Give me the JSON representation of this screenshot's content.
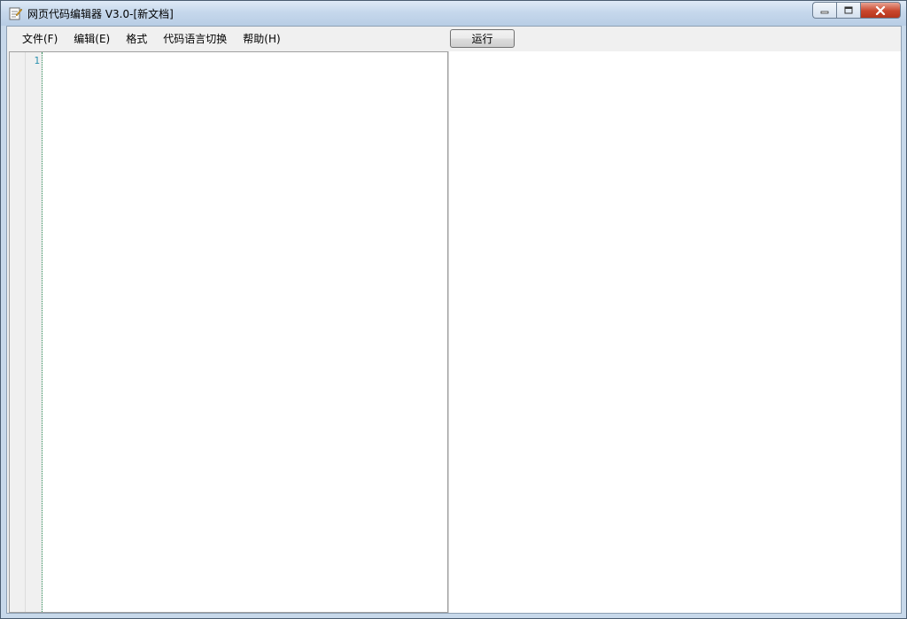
{
  "window": {
    "title": "网页代码编辑器 V3.0-[新文档]",
    "icon": "notepad-icon"
  },
  "menubar": {
    "items": [
      {
        "label": "文件(F)"
      },
      {
        "label": "编辑(E)"
      },
      {
        "label": "格式"
      },
      {
        "label": "代码语言切换"
      },
      {
        "label": "帮助(H)"
      }
    ]
  },
  "toolbar": {
    "run_label": "运行"
  },
  "editor": {
    "line_numbers": [
      "1"
    ],
    "content": ""
  },
  "colors": {
    "line_number": "#2b91af",
    "gutter_guide": "#2e8b57",
    "close_button": "#c9462c"
  }
}
